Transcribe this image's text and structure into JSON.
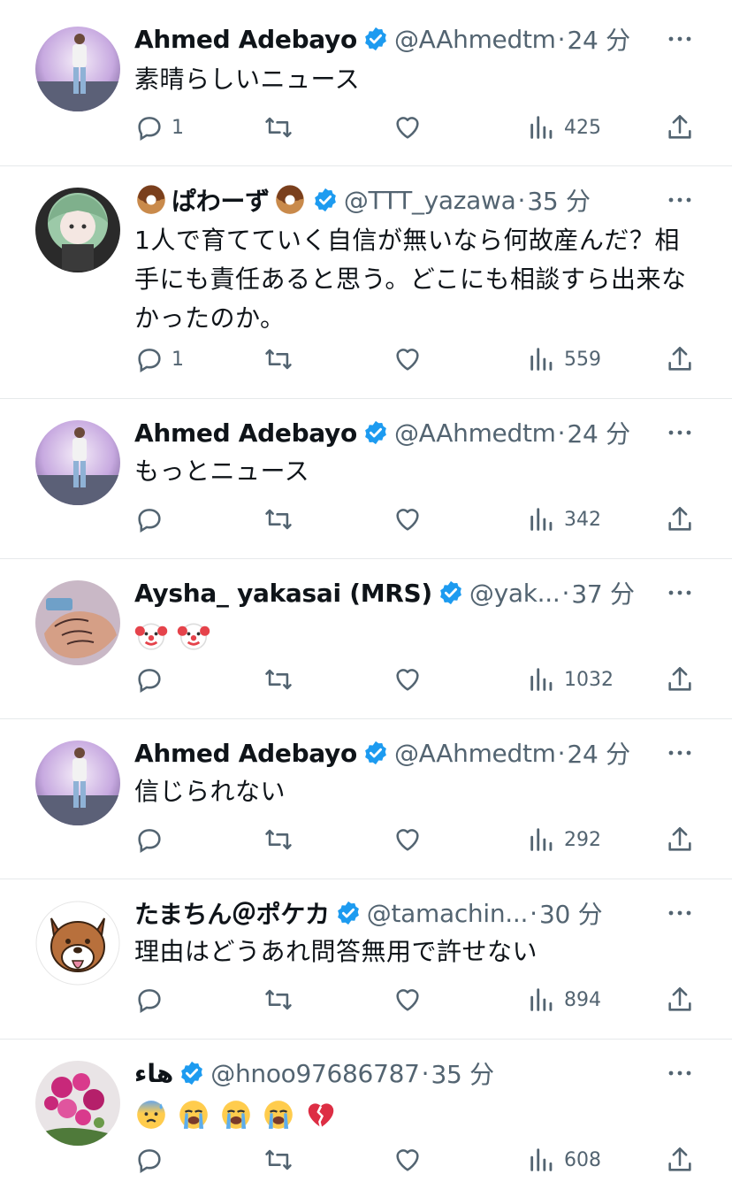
{
  "colors": {
    "accent": "#1d9bf0",
    "text": "#0f1419",
    "muted": "#536471",
    "divider": "#e6e9eb"
  },
  "tweets": [
    {
      "name": "Ahmed Adebayo",
      "handle": "@AAhmedtm",
      "dot": "·",
      "time": "24 分",
      "text": "素晴らしいニュース",
      "replies": "1",
      "views": "425"
    },
    {
      "name": "ぱわーず",
      "handle": "@TTT_yazawa",
      "dot": "·",
      "time": "35 分",
      "text": "1人で育てていく自信が無いなら何故産んだ？相手にも責任あると思う。どこにも相談すら出来なかったのか。",
      "replies": "1",
      "views": "559"
    },
    {
      "name": "Ahmed Adebayo",
      "handle": "@AAhmedtm",
      "dot": "·",
      "time": "24 分",
      "text": "もっとニュース",
      "replies": "",
      "views": "342"
    },
    {
      "name": "Aysha_ yakasai (MRS)",
      "handle": "@yak...",
      "dot": "·",
      "time": "37 分",
      "text": "",
      "replies": "",
      "views": "1032"
    },
    {
      "name": "Ahmed Adebayo",
      "handle": "@AAhmedtm",
      "dot": "·",
      "time": "24 分",
      "text": "信じられない",
      "replies": "",
      "views": "292"
    },
    {
      "name": "たまちん＠ポケカ",
      "handle": "@tamachin...",
      "dot": "·",
      "time": "30 分",
      "text": "理由はどうあれ問答無用で許せない",
      "replies": "",
      "views": "894"
    },
    {
      "name": "هاء",
      "handle": "@hnoo97686787",
      "dot": "·",
      "time": "35 分",
      "text": "",
      "replies": "",
      "views": "608"
    }
  ],
  "icons": {
    "reply": "reply-icon",
    "retweet": "retweet-icon",
    "like": "heart-icon",
    "views": "views-chart-icon",
    "share": "share-icon",
    "verified": "verified-badge-icon",
    "more": "more-dots-icon"
  }
}
